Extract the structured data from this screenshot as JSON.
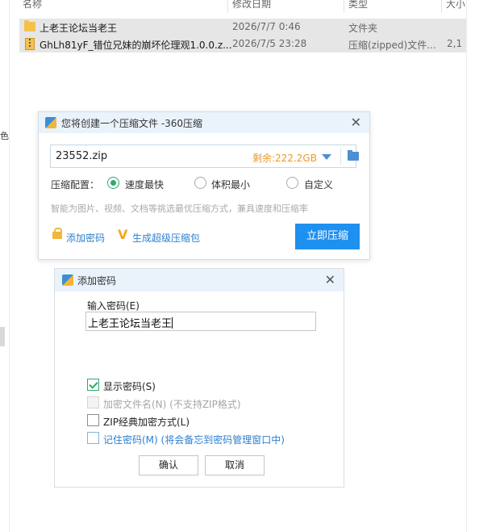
{
  "explorer": {
    "columns": [
      "名称",
      "修改日期",
      "类型",
      "大小"
    ],
    "files": [
      {
        "name": "上老王论坛当老王",
        "date": "2026/7/7 0:46",
        "type": "文件夹",
        "size": ""
      },
      {
        "name": "GhLh81yF_错位兄妹的崩坏伦理观1.0.0.z...",
        "date": "2026/7/5 23:28",
        "type": "压缩(zipped)文件...",
        "size": "2,1"
      }
    ],
    "left_glyph": "色"
  },
  "compress_dialog": {
    "title": "您将创建一个压缩文件 -360压缩",
    "filename": "23552.zip",
    "free_space": "剩余:222.2GB",
    "config_label": "压缩配置：",
    "options": [
      {
        "label": "速度最快",
        "selected": true
      },
      {
        "label": "体积最小",
        "selected": false
      },
      {
        "label": "自定义",
        "selected": false
      }
    ],
    "hint": "智能为图片、视频、文档等挑选最优压缩方式，兼具速度和压缩率",
    "add_password_link": "添加密码",
    "super_package_link": "生成超级压缩包",
    "compress_button": "立即压缩",
    "close_glyph": "✕"
  },
  "password_dialog": {
    "title": "添加密码",
    "input_label": "输入密码(E)",
    "password_value": "上老王论坛当老王",
    "checkboxes": [
      {
        "label": "显示密码(S)",
        "checked": true,
        "state": "checked"
      },
      {
        "label": "加密文件名(N) (不支持ZIP格式)",
        "checked": false,
        "state": "disabled"
      },
      {
        "label": "ZIP经典加密方式(L)",
        "checked": false,
        "state": "normal"
      },
      {
        "label": "记住密码(M) (将会备忘到密码管理窗口中)",
        "checked": false,
        "state": "blue"
      }
    ],
    "ok_button": "确认",
    "cancel_button": "取消",
    "close_glyph": "✕"
  },
  "colors": {
    "accent": "#1e90f0",
    "free_space": "#e99a2a",
    "radio_selected": "#2ea96b",
    "link": "#2d7fd0",
    "title_bar": "#eaf3fb"
  }
}
